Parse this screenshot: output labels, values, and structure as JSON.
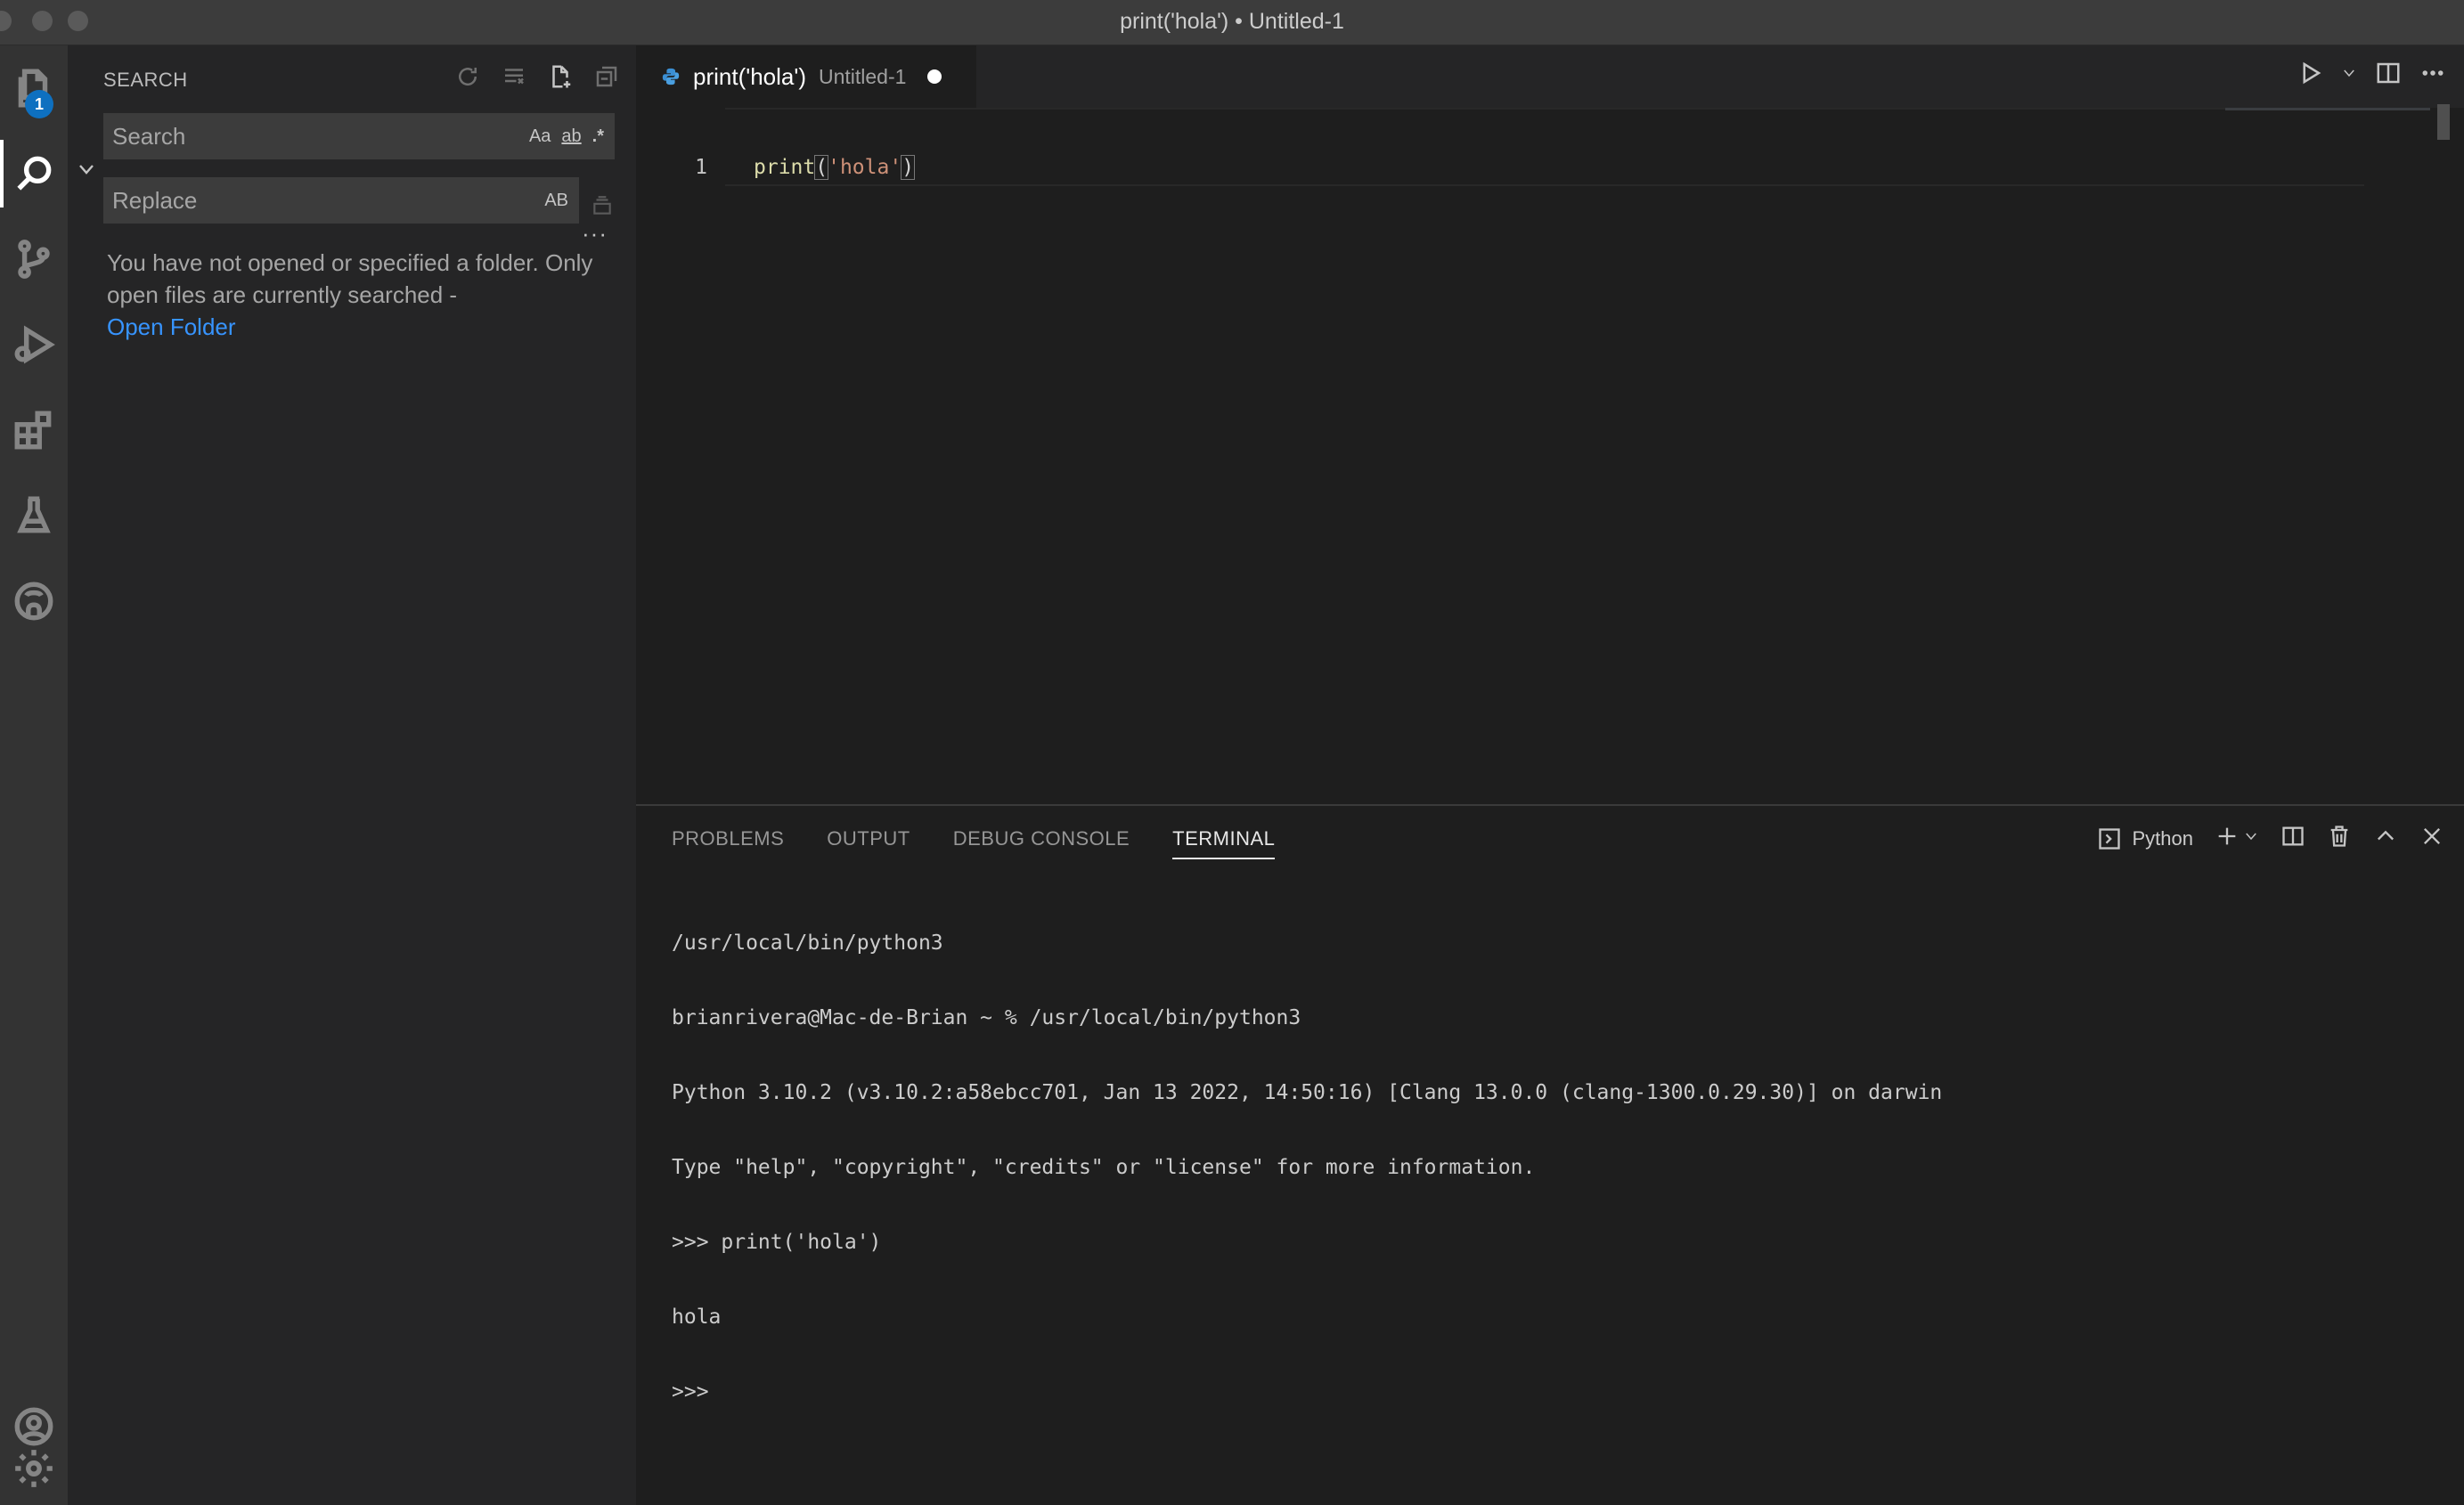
{
  "window": {
    "title": "print('hola') • Untitled-1"
  },
  "activity_bar": {
    "items": [
      {
        "name": "explorer",
        "icon": "files-icon",
        "badge": "1"
      },
      {
        "name": "search",
        "icon": "search-icon",
        "active": true
      },
      {
        "name": "source-control",
        "icon": "source-control-icon"
      },
      {
        "name": "run-debug",
        "icon": "run-debug-icon"
      },
      {
        "name": "extensions",
        "icon": "extensions-icon"
      },
      {
        "name": "testing",
        "icon": "beaker-icon"
      },
      {
        "name": "github",
        "icon": "github-icon"
      }
    ],
    "bottom": [
      {
        "name": "accounts",
        "icon": "account-icon"
      },
      {
        "name": "manage",
        "icon": "gear-icon"
      }
    ]
  },
  "sidebar": {
    "title": "SEARCH",
    "search": {
      "placeholder": "Search",
      "value": "",
      "opt_case": "Aa",
      "opt_word": "ab",
      "opt_regex": ".*"
    },
    "replace": {
      "placeholder": "Replace",
      "value": "",
      "opt_preserve": "AB"
    },
    "message": "You have not opened or specified a folder. Only open files are currently searched -",
    "open_folder": "Open Folder"
  },
  "editor": {
    "tab": {
      "name": "print('hola')",
      "description": "Untitled-1",
      "dirty": true
    },
    "line_number": "1",
    "code": {
      "fn": "print",
      "open": "(",
      "str": "'hola'",
      "close": ")"
    }
  },
  "panel": {
    "tabs": [
      "PROBLEMS",
      "OUTPUT",
      "DEBUG CONSOLE",
      "TERMINAL"
    ],
    "active_tab": "TERMINAL",
    "terminal_name": "Python",
    "terminal_lines": [
      "/usr/local/bin/python3",
      "brianrivera@Mac-de-Brian ~ % /usr/local/bin/python3",
      "Python 3.10.2 (v3.10.2:a58ebcc701, Jan 13 2022, 14:50:16) [Clang 13.0.0 (clang-1300.0.29.30)] on darwin",
      "Type \"help\", \"copyright\", \"credits\" or \"license\" for more information.",
      ">>> print('hola')",
      "hola",
      ">>> "
    ]
  },
  "colors": {
    "accent": "#0e70c0",
    "link": "#3794ff",
    "string": "#ce9178",
    "function": "#dcdcaa"
  }
}
